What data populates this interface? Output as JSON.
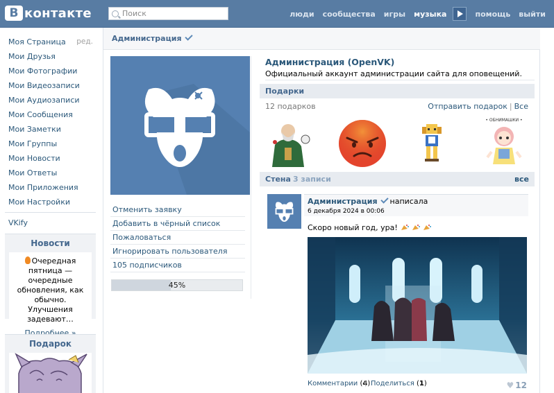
{
  "header": {
    "logo_letter": "В",
    "logo_text": "контакте",
    "search_placeholder": "Поиск",
    "nav": [
      "люди",
      "сообщества",
      "игры",
      "музыка",
      "помощь",
      "выйти"
    ],
    "active_nav": "музыка"
  },
  "leftmenu": {
    "items": [
      "Моя Страница",
      "Мои Друзья",
      "Мои Фотографии",
      "Мои Видеозаписи",
      "Мои Аудиозаписи",
      "Мои Сообщения",
      "Мои Заметки",
      "Мои Группы",
      "Мои Новости",
      "Мои Ответы",
      "Мои Приложения",
      "Мои Настройки"
    ],
    "edit_label": "ред.",
    "extra": "VKify"
  },
  "news": {
    "title": "Новости",
    "text": "Очередная пятница — очередные обновления, как обычно. Улучшения задевают…",
    "more": "Подробнее »"
  },
  "gift_box": {
    "title": "Подарок"
  },
  "page": {
    "header_title": "Администрация",
    "name": "Администрация (OpenVK)",
    "description": "Официальный аккаунт администрации сайта для оповещений.",
    "actions": [
      "Отменить заявку",
      "Добавить в чёрный список",
      "Пожаловаться",
      "Игнорировать пользователя",
      "105 подписчиков"
    ],
    "progress_text": "45%",
    "progress_fraction": 0.45
  },
  "gifts": {
    "title": "Подарки",
    "count": "12 подарков",
    "send": "Отправить подарок",
    "all": "Все",
    "sticker_caption": "• ОБНИМАШКИ •"
  },
  "wall": {
    "title": "Стена",
    "count": "3 записи",
    "all": "все"
  },
  "post": {
    "author": "Администрация",
    "wrote": "написала",
    "date": "6 декабря 2024 в 00:06",
    "text": "Скоро новый год, ура!",
    "comments_label": "Комментарии",
    "comments_count": "4",
    "share_label": "Поделиться",
    "share_count": "1",
    "likes": "12"
  },
  "colors": {
    "header": "#587ca3",
    "link": "#2b587a",
    "accent": "#5580b1"
  }
}
